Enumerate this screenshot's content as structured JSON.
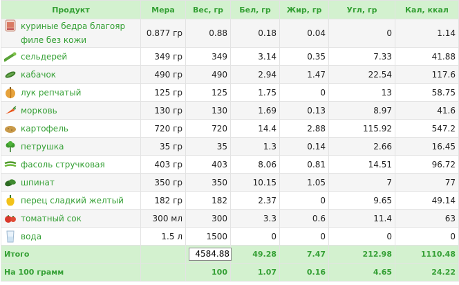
{
  "headers": [
    "Продукт",
    "Мера",
    "Вес, гр",
    "Бел, гр",
    "Жир, гр",
    "Угл, гр",
    "Кал, ккал"
  ],
  "rows": [
    {
      "icon": "chicken-thigh-icon",
      "name": "куриные бедра благояр филе без кожи",
      "measure": "0.877 гр",
      "weight": "0.88",
      "protein": "0.18",
      "fat": "0.04",
      "carbs": "0",
      "kcal": "1.14"
    },
    {
      "icon": "celery-icon",
      "name": "сельдерей",
      "measure": "349 гр",
      "weight": "349",
      "protein": "3.14",
      "fat": "0.35",
      "carbs": "7.33",
      "kcal": "41.88"
    },
    {
      "icon": "zucchini-icon",
      "name": "кабачок",
      "measure": "490 гр",
      "weight": "490",
      "protein": "2.94",
      "fat": "1.47",
      "carbs": "22.54",
      "kcal": "117.6"
    },
    {
      "icon": "onion-icon",
      "name": "лук репчатый",
      "measure": "125 гр",
      "weight": "125",
      "protein": "1.75",
      "fat": "0",
      "carbs": "13",
      "kcal": "58.75"
    },
    {
      "icon": "carrot-icon",
      "name": "морковь",
      "measure": "130 гр",
      "weight": "130",
      "protein": "1.69",
      "fat": "0.13",
      "carbs": "8.97",
      "kcal": "41.6"
    },
    {
      "icon": "potato-icon",
      "name": "картофель",
      "measure": "720 гр",
      "weight": "720",
      "protein": "14.4",
      "fat": "2.88",
      "carbs": "115.92",
      "kcal": "547.2"
    },
    {
      "icon": "parsley-icon",
      "name": "петрушка",
      "measure": "35 гр",
      "weight": "35",
      "protein": "1.3",
      "fat": "0.14",
      "carbs": "2.66",
      "kcal": "16.45"
    },
    {
      "icon": "green-beans-icon",
      "name": "фасоль стручковая",
      "measure": "403 гр",
      "weight": "403",
      "protein": "8.06",
      "fat": "0.81",
      "carbs": "14.51",
      "kcal": "96.72"
    },
    {
      "icon": "spinach-icon",
      "name": "шпинат",
      "measure": "350 гр",
      "weight": "350",
      "protein": "10.15",
      "fat": "1.05",
      "carbs": "7",
      "kcal": "77"
    },
    {
      "icon": "yellow-pepper-icon",
      "name": "перец сладкий желтый",
      "measure": "182 гр",
      "weight": "182",
      "protein": "2.37",
      "fat": "0",
      "carbs": "9.65",
      "kcal": "49.14"
    },
    {
      "icon": "tomato-icon",
      "name": "томатный сок",
      "measure": "300 мл",
      "weight": "300",
      "protein": "3.3",
      "fat": "0.6",
      "carbs": "11.4",
      "kcal": "63"
    },
    {
      "icon": "water-glass-icon",
      "name": "вода",
      "measure": "1.5 л",
      "weight": "1500",
      "protein": "0",
      "fat": "0",
      "carbs": "0",
      "kcal": "0"
    }
  ],
  "total": {
    "label": "Итого",
    "weight": "4584.88",
    "protein": "49.28",
    "fat": "7.47",
    "carbs": "212.98",
    "kcal": "1110.48"
  },
  "per100": {
    "label": "На 100 грамм",
    "weight": "100",
    "protein": "1.07",
    "fat": "0.16",
    "carbs": "4.65",
    "kcal": "24.22"
  }
}
